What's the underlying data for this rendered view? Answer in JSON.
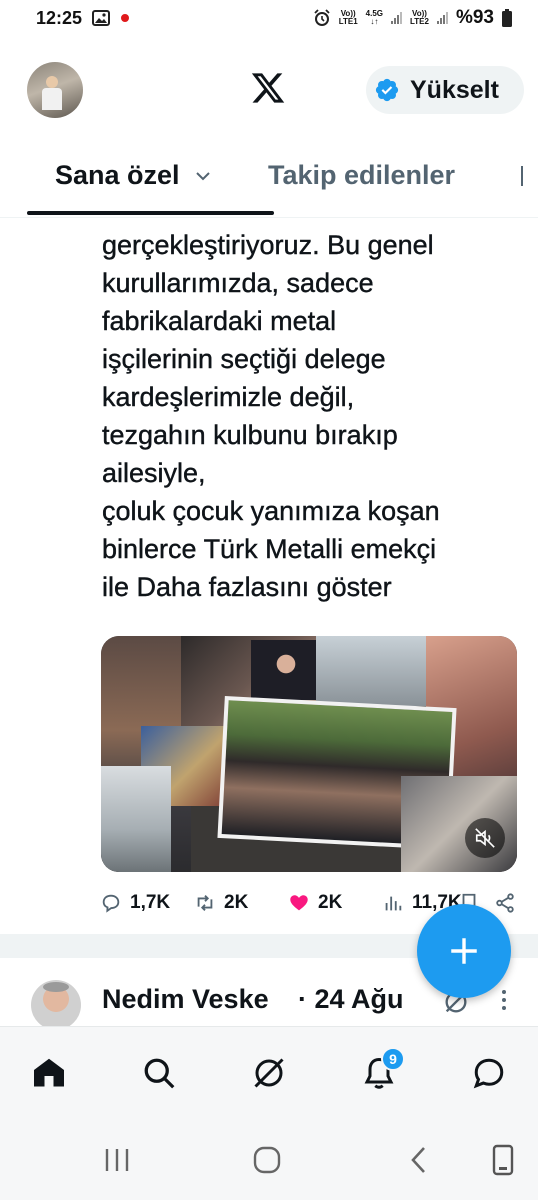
{
  "status_bar": {
    "time": "12:25",
    "sim1_label_top": "Vo))",
    "sim1_label_bottom": "LTE1",
    "sim1_net": "4.5G",
    "sim2_label_top": "Vo))",
    "sim2_label_bottom": "LTE2",
    "battery": "%93",
    "icons": [
      "image-icon",
      "notification-dot-icon",
      "alarm-icon",
      "signal-icon",
      "battery-icon"
    ]
  },
  "header": {
    "logo": "x-logo",
    "upgrade_label": "Yükselt"
  },
  "tabs": {
    "for_you": "Sana özel",
    "following": "Takip edilenler"
  },
  "tweet": {
    "text": "kurullarımızı\ngerçekleştiriyoruz. Bu genel\nkurullarımızda, sadece\nfabrikalardaki metal\nişçilerinin seçtiği delege\nkardeşlerimizle değil,\ntezgahın kulbunu bırakıp\nailesiyle,\nçoluk çocuk yanımıza koşan\nbinlerce Türk Metalli emekçi\nile Daha fazlasını göster",
    "media": "video-collage",
    "replies": "1,7K",
    "retweets": "2K",
    "likes": "2K",
    "views": "11,7K",
    "colors": {
      "like": "#f91880",
      "accent": "#1d9bf0"
    }
  },
  "next_tweet": {
    "name": "Nedim Veske",
    "date": "· 24 Ağu"
  },
  "bottom_nav": {
    "notification_count": "9",
    "items": [
      "home-icon",
      "search-icon",
      "grok-icon",
      "notifications-icon",
      "messages-icon"
    ]
  },
  "system_nav": [
    "recents-icon",
    "home-circle-icon",
    "back-icon",
    "screenshot-icon"
  ]
}
